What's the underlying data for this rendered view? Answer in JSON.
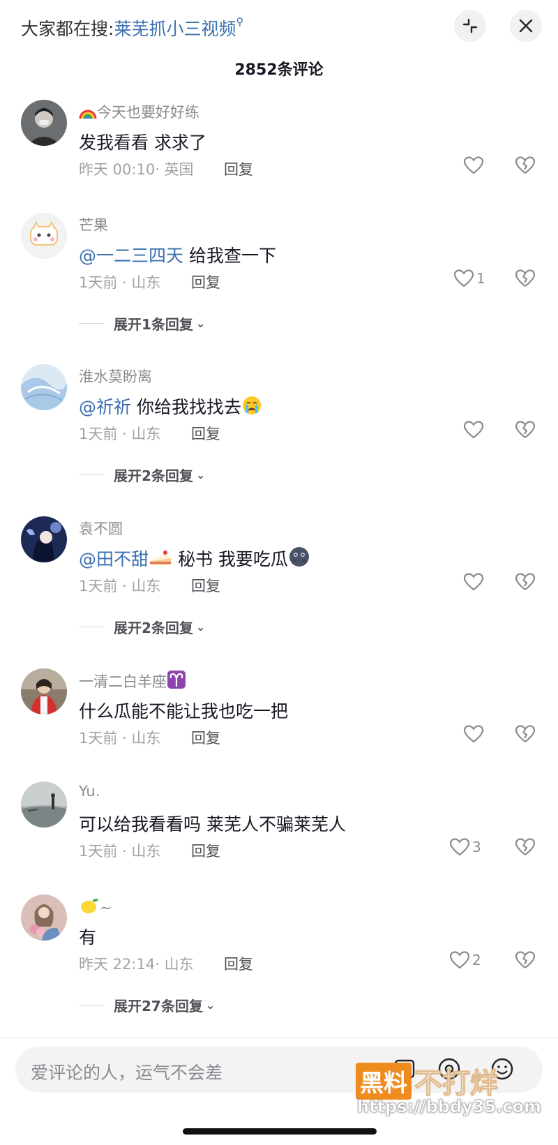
{
  "header": {
    "search_prefix": "大家都在搜:",
    "search_keyword": "莱芜抓小三视频",
    "comment_count": "2852条评论"
  },
  "comments": [
    {
      "username": "今天也要好好练",
      "username_prefix_icon": "rainbow-emoji",
      "mention": "",
      "text": "发我看看 求求了",
      "time": "昨天 00:10",
      "location": "英国",
      "reply_label": "回复",
      "likes": "",
      "expand": ""
    },
    {
      "username": "芒果",
      "mention": "@一二三四天",
      "text": "给我查一下",
      "time": "1天前",
      "location": "山东",
      "reply_label": "回复",
      "likes": "1",
      "expand": "展开1条回复"
    },
    {
      "username": "淮水莫盼离",
      "mention": "@祈祈",
      "text": "你给我找找去",
      "text_suffix_icon": "crying-emoji",
      "time": "1天前",
      "location": "山东",
      "reply_label": "回复",
      "likes": "",
      "expand": "展开2条回复"
    },
    {
      "username": "袁不圆",
      "mention": "@田不甜",
      "mention_suffix_icon": "cake-emoji",
      "text": "秘书 我要吃瓜",
      "text_suffix_icon": "moon-face-emoji",
      "time": "1天前",
      "location": "山东",
      "reply_label": "回复",
      "likes": "",
      "expand": "展开2条回复"
    },
    {
      "username": "一清二白羊座",
      "username_suffix_icon": "aries-emoji",
      "mention": "",
      "text": "什么瓜能不能让我也吃一把",
      "time": "1天前",
      "location": "山东",
      "reply_label": "回复",
      "likes": "",
      "expand": ""
    },
    {
      "username": "Yu.",
      "mention": "",
      "text": "可以给我看看吗 莱芜人不骗莱芜人",
      "time": "1天前",
      "location": "山东",
      "reply_label": "回复",
      "likes": "3",
      "expand": ""
    },
    {
      "username": "~",
      "username_prefix_icon": "lemon-emoji",
      "mention": "",
      "text": "有",
      "time": "昨天 22:14",
      "location": "山东",
      "reply_label": "回复",
      "likes": "2",
      "expand": "展开27条回复"
    }
  ],
  "input": {
    "placeholder": "爱评论的人，运气不会差"
  },
  "watermark": {
    "box": "黑料",
    "text": "不打烊",
    "url": "https://bbdy35.com"
  },
  "colors": {
    "link": "#3a6fb0",
    "secondary_text": "#8a8b91",
    "primary_text": "#161823",
    "watermark_orange": "#f08c1e"
  }
}
